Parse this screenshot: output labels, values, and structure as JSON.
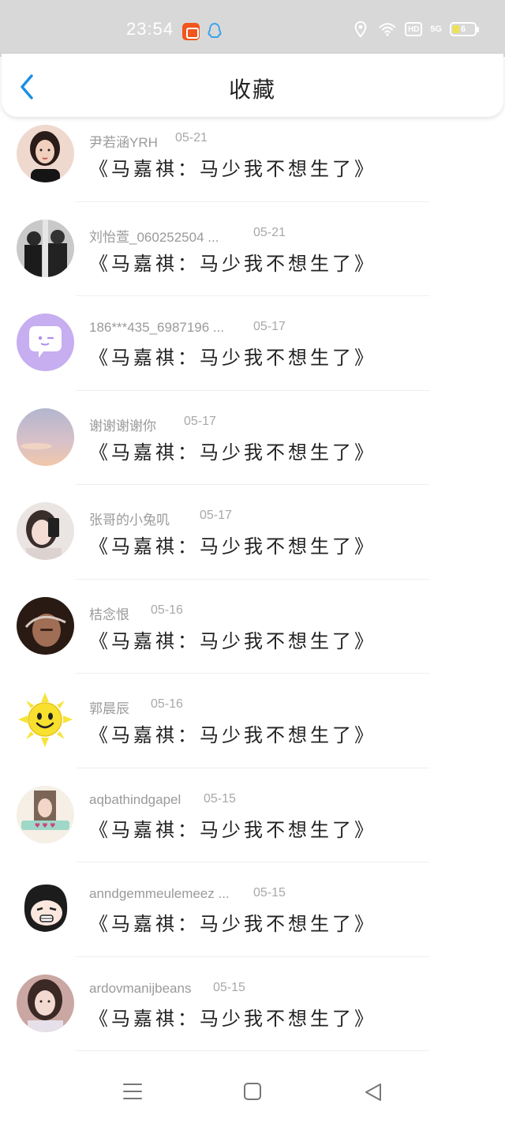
{
  "status_bar": {
    "time": "23:54",
    "network": "5G",
    "hd": "HD",
    "battery": "6",
    "battery_color": "#f2e24a"
  },
  "header": {
    "title": "收藏",
    "back_icon": "chevron-left-icon",
    "accent": "#1a8fe3"
  },
  "favorites": [
    {
      "name": "尹若涵YRH",
      "date": "05-21",
      "title": "《马嘉祺：马少我不想生了》",
      "avatar_icon": "girl-portrait-avatar"
    },
    {
      "name": "刘怡萱_060252504 ...",
      "date": "05-21",
      "title": "《马嘉祺：马少我不想生了》",
      "avatar_icon": "couple-photo-avatar"
    },
    {
      "name": "186***435_6987196 ...",
      "date": "05-17",
      "title": "《马嘉祺：马少我不想生了》",
      "avatar_icon": "chat-bubble-avatar"
    },
    {
      "name": "谢谢谢谢你",
      "date": "05-17",
      "title": "《马嘉祺：马少我不想生了》",
      "avatar_icon": "sky-photo-avatar"
    },
    {
      "name": "张哥的小兔叽",
      "date": "05-17",
      "title": "《马嘉祺：马少我不想生了》",
      "avatar_icon": "selfie-avatar"
    },
    {
      "name": "桔念恨",
      "date": "05-16",
      "title": "《马嘉祺：马少我不想生了》",
      "avatar_icon": "dark-portrait-avatar"
    },
    {
      "name": "郭晨辰",
      "date": "05-16",
      "title": "《马嘉祺：马少我不想生了》",
      "avatar_icon": "sun-smiley-avatar"
    },
    {
      "name": "aqbathindgapel",
      "date": "05-15",
      "title": "《马嘉祺：马少我不想生了》",
      "avatar_icon": "girl-caption-avatar"
    },
    {
      "name": "anndgemmeulemeez ...",
      "date": "05-15",
      "title": "《马嘉祺：马少我不想生了》",
      "avatar_icon": "cartoon-face-avatar"
    },
    {
      "name": "ardovmanijbeans",
      "date": "05-15",
      "title": "《马嘉祺：马少我不想生了》",
      "avatar_icon": "girl-photo-avatar"
    }
  ],
  "nav": {
    "menu_icon": "menu-icon",
    "home_icon": "square-home-icon",
    "back_icon": "triangle-back-icon"
  }
}
